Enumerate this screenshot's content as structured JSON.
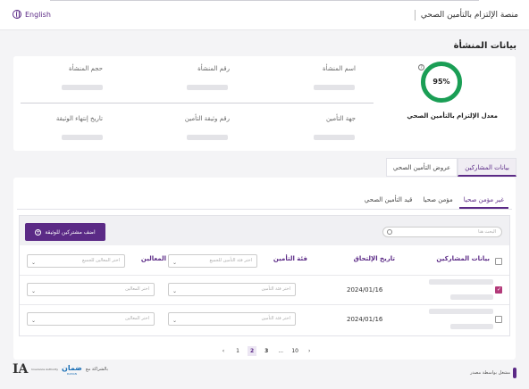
{
  "header": {
    "title": "منصة الإلتزام بالتأمين الصحي",
    "language_toggle": "English",
    "icons": {
      "language": "globe-icon"
    }
  },
  "facility": {
    "section_title": "بيانات المنشأة",
    "compliance": {
      "percent": 95,
      "percent_label": "95%",
      "label": "معدل الإلتزام بالتأمين الصحي",
      "ring_color": "#1a9e55"
    },
    "fields": {
      "name": "اسم المنشأة",
      "number": "رقم المنشأة",
      "size": "حجم المنشأة",
      "insurer": "جهة التأمين",
      "policy_number": "رقم وثيقة التأمين",
      "policy_expiry": "تاريخ إنتهاء الوثيقة"
    }
  },
  "tabs": [
    "بيانات المشاركين",
    "عروض التأمين الصحي"
  ],
  "subtabs": [
    "غير مؤمن صحيا",
    "مؤمن صحيا",
    "قيد التأمين الصحي"
  ],
  "table": {
    "add_button": "اضف مشتركين للوثيقة",
    "search_placeholder": "البحث هنا",
    "headers": {
      "participants": "بيانات المشاركين",
      "due_date": "تاريخ الإلتحاق",
      "insurance_class": "فئة التأمين",
      "dependents": "المعالين"
    },
    "header_selects": {
      "insurance_class": "اختر فئة التأمين للجميع",
      "dependents": "اختر المعالين للجميع"
    },
    "rows": [
      {
        "date": "2024/01/16",
        "checked": true,
        "class_placeholder": "اختر فئة التأمين",
        "dependents_placeholder": "اختر المعالين"
      },
      {
        "date": "2024/01/16",
        "checked": false,
        "class_placeholder": "اختر فئة التأمين",
        "dependents_placeholder": "اختر المعالين"
      }
    ]
  },
  "pagination": {
    "prev": "‹",
    "next": "›",
    "pages": [
      "1",
      "2",
      "3",
      "...",
      "10"
    ],
    "current": "2"
  },
  "footer": {
    "operated_by": "مشغل بواسطة مصدر",
    "partnership": "بالشراكة مع",
    "logo_text": "IA",
    "daman": "ضمان",
    "daman_sub": "DAMAN",
    "authority": "Insurance Authority"
  },
  "colors": {
    "accent": "#5b2a86",
    "success": "#1a9e55",
    "checkbox": "#b33a7a"
  }
}
